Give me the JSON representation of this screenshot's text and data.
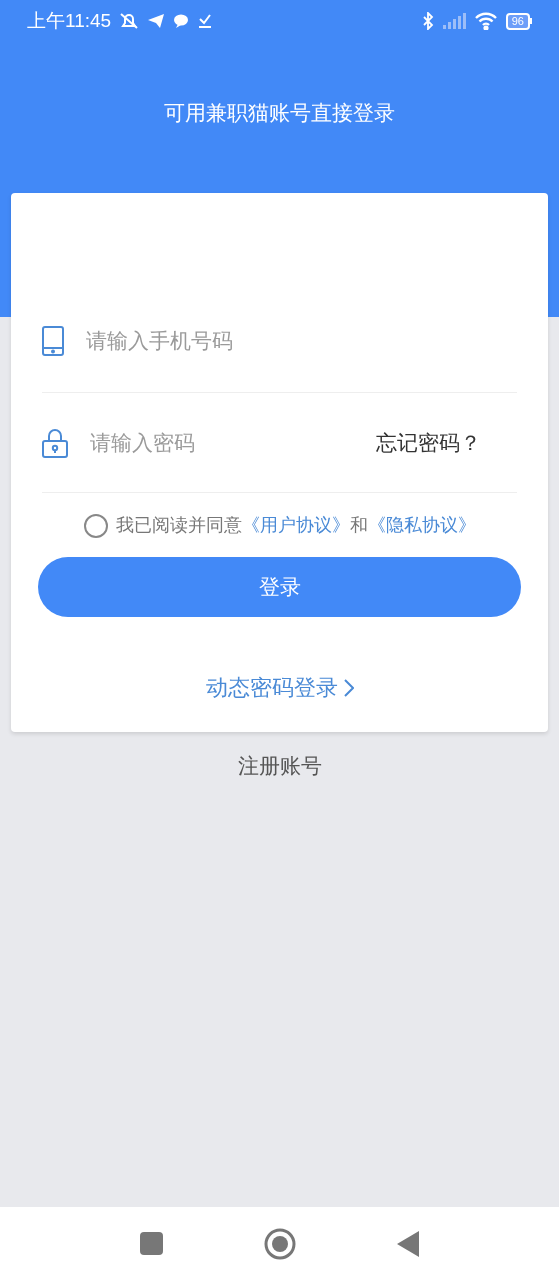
{
  "status_bar": {
    "time": "上午11:45",
    "battery": "96"
  },
  "header": {
    "title": "可用兼职猫账号直接登录"
  },
  "phone_field": {
    "placeholder": "请输入手机号码"
  },
  "password_field": {
    "placeholder": "请输入密码",
    "forgot": "忘记密码？"
  },
  "agreement": {
    "checked": false,
    "text": "我已阅读并同意",
    "user_link": "《用户协议》",
    "joiner": "和",
    "privacy_link": "《隐私协议》"
  },
  "login_button": "登录",
  "dynamic_login": "动态密码登录",
  "register": "注册账号"
}
